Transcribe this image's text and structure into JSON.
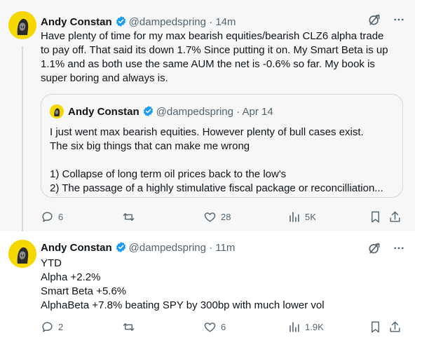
{
  "tweets": [
    {
      "author": "Andy Constan",
      "handle": "@dampedspring",
      "separator": "·",
      "time": "14m",
      "lines": [
        "Have plenty of time for my max bearish equities/bearish CLZ6 alpha trade",
        "to pay off.  That said its down 1.7% Since putting it on.  My Smart Beta is up",
        "1.1% and as both use the same AUM the net is -0.6% so far.  My book is",
        "super boring and always is."
      ],
      "quote": {
        "author": "Andy Constan",
        "handle": "@dampedspring",
        "separator": "·",
        "time": "Apr 14",
        "lines": [
          "I just went max bearish equities.  However plenty of bull cases exist.",
          "The six big things that can make me wrong",
          "",
          "1) Collapse of long term oil prices back to the low's",
          "2) The passage of a highly stimulative fiscal package or reconcilliation..."
        ]
      },
      "metrics": {
        "replies": "6",
        "retweets": "",
        "likes": "28",
        "views": "5K"
      }
    },
    {
      "author": "Andy Constan",
      "handle": "@dampedspring",
      "separator": "·",
      "time": "11m",
      "lines": [
        "YTD",
        "Alpha +2.2%",
        "Smart Beta +5.6%",
        "AlphaBeta +7.8% beating SPY by 300bp with much lower vol"
      ],
      "metrics": {
        "replies": "2",
        "retweets": "",
        "likes": "6",
        "views": "1.9K"
      }
    }
  ],
  "colors": {
    "verified": "#1d9bf0",
    "secondary_text": "#536471",
    "avatar_bg": "#f4d800"
  },
  "icons": [
    "verified-badge-icon",
    "grok-icon",
    "more-icon",
    "reply-icon",
    "retweet-icon",
    "like-icon",
    "views-icon",
    "bookmark-icon",
    "share-icon"
  ]
}
